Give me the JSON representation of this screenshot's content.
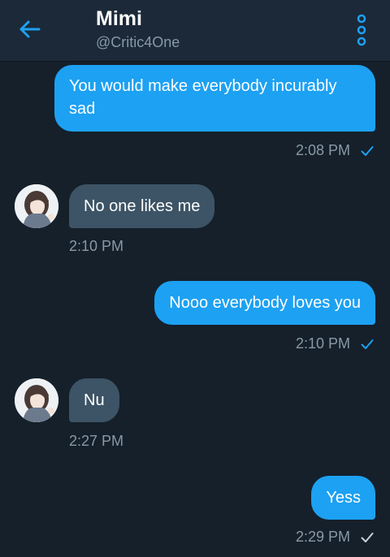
{
  "header": {
    "title": "Mimi",
    "handle": "@Critic4One"
  },
  "colors": {
    "background": "#15202b",
    "header": "#1c2938",
    "accent": "#1da1f2",
    "incoming_bubble": "#3d5466",
    "muted_text": "#8899a6"
  },
  "messages": [
    {
      "direction": "outgoing",
      "text": "You would make everybody incurably sad",
      "time": "2:08 PM",
      "status": "read-check-icon"
    },
    {
      "direction": "incoming",
      "text": "No one likes me",
      "time": "2:10 PM"
    },
    {
      "direction": "outgoing",
      "text": "Nooo everybody loves you",
      "time": "2:10 PM",
      "status": "read-check-icon"
    },
    {
      "direction": "incoming",
      "text": "Nu",
      "time": "2:27 PM"
    },
    {
      "direction": "outgoing",
      "text": "Yess",
      "time": "2:29 PM",
      "status": "sent-check-icon"
    }
  ]
}
